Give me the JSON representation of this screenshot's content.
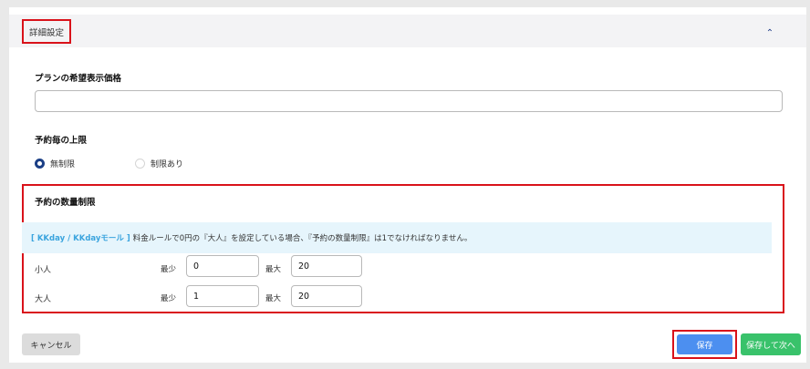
{
  "header": {
    "title": "詳細設定",
    "collapse_icon": "chevron-up-icon",
    "collapse_glyph": "⌃"
  },
  "desired_price": {
    "label": "プランの希望表示価格",
    "value": "",
    "placeholder": ""
  },
  "booking_limit": {
    "label": "予約毎の上限",
    "options": [
      {
        "label": "無制限",
        "selected": true
      },
      {
        "label": "制限あり",
        "selected": false
      }
    ]
  },
  "quantity_limit": {
    "label": "予約の数量制限",
    "notice_accent": "[ KKday / KKdayモール ]",
    "notice_text": "料金ルールで0円の『大人』を設定している場合、『予約の数量制限』は1でなければなりません。",
    "min_label": "最少",
    "max_label": "最大",
    "rows": [
      {
        "label": "小人",
        "min": "0",
        "max": "20"
      },
      {
        "label": "大人",
        "min": "1",
        "max": "20"
      }
    ]
  },
  "footer": {
    "cancel_label": "キャンセル",
    "save_label": "保存",
    "save_next_label": "保存して次へ"
  },
  "colors": {
    "primary": "#1b3f86",
    "save": "#4c8ff0",
    "save_next": "#39c26b",
    "notice_bg": "#e6f5fc",
    "notice_accent": "#3aa4de",
    "highlight": "#d9121a"
  }
}
